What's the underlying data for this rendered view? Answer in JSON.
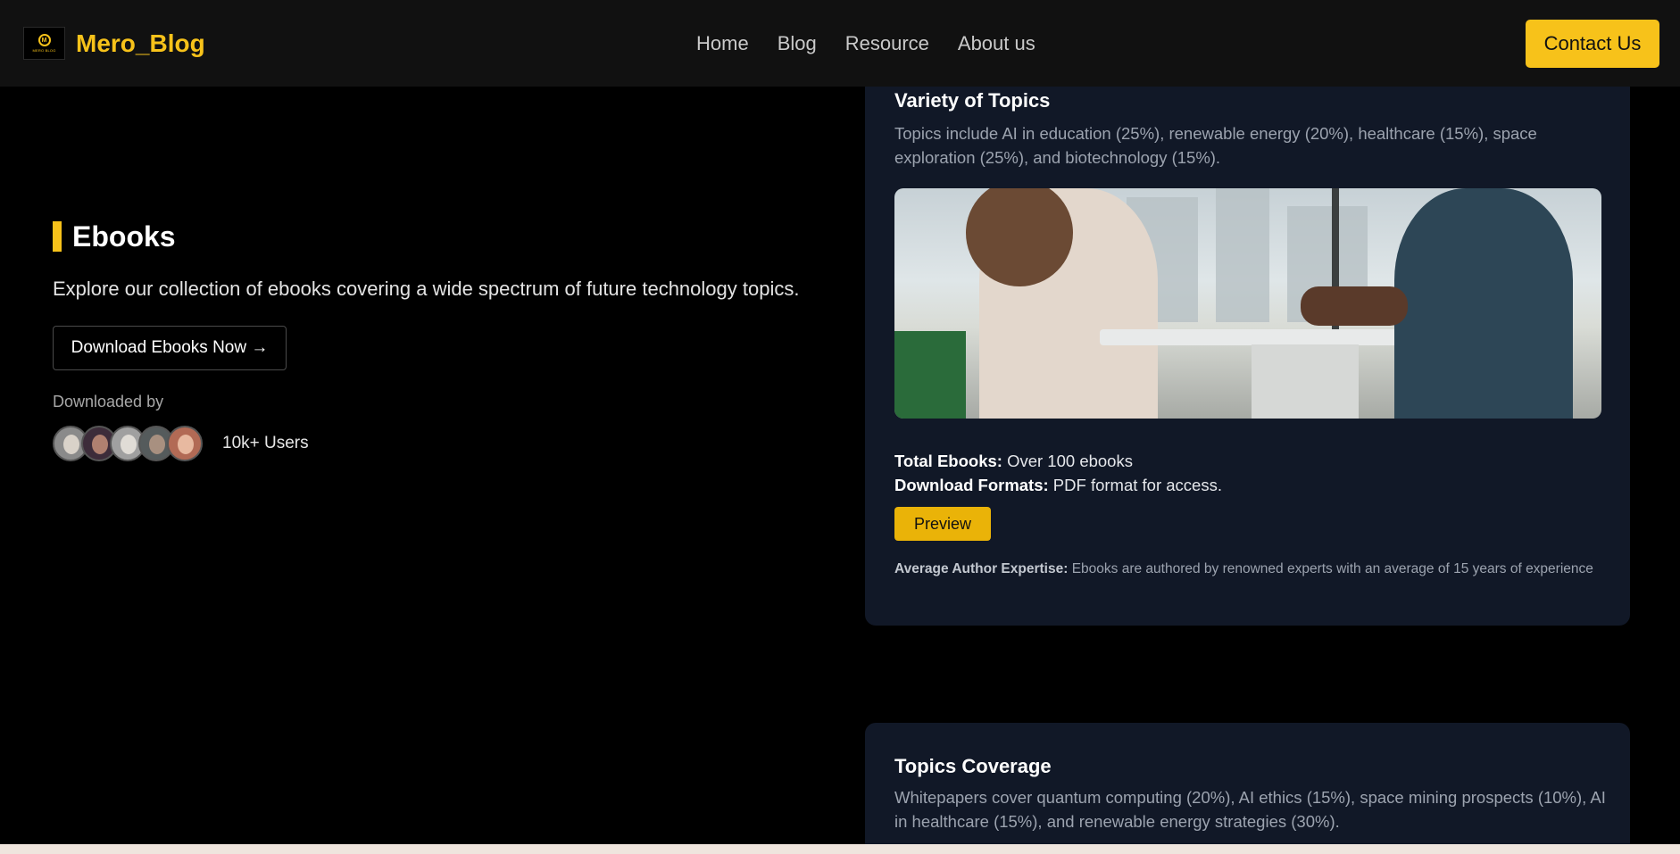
{
  "header": {
    "logo_icon": "logo-badge",
    "logo_glyph": "M",
    "logo_sub": "MERO BLOG",
    "brand": "Mero_Blog",
    "nav": [
      "Home",
      "Blog",
      "Resource",
      "About us"
    ],
    "contact_label": "Contact Us"
  },
  "hero": {
    "title": "Ebooks",
    "description": "Explore our collection of ebooks covering a wide spectrum of future technology topics.",
    "download_label": "Download Ebooks Now →",
    "downloaded_by": "Downloaded by",
    "users_count": "10k+ Users"
  },
  "card1": {
    "title": "Variety of Topics",
    "description": "Topics include AI in education (25%), renewable energy (20%), healthcare (15%), space exploration (25%), and biotechnology (15%).",
    "total_label": "Total Ebooks:",
    "total_value": " Over 100 ebooks",
    "formats_label": "Download Formats:",
    "formats_value": " PDF format for access.",
    "preview_label": "Preview",
    "expertise_label": "Average Author Expertise:",
    "expertise_value": " Ebooks are authored by renowned experts with an average of 15 years of experience"
  },
  "card2": {
    "title": "Topics Coverage",
    "description": "Whitepapers cover quantum computing (20%), AI ethics (15%), space mining prospects (10%), AI in healthcare (15%), and renewable energy strategies (30%)."
  },
  "colors": {
    "accent": "#f7c21a",
    "card_bg": "#111827",
    "header_bg": "#111111",
    "page_bg": "#000000"
  }
}
